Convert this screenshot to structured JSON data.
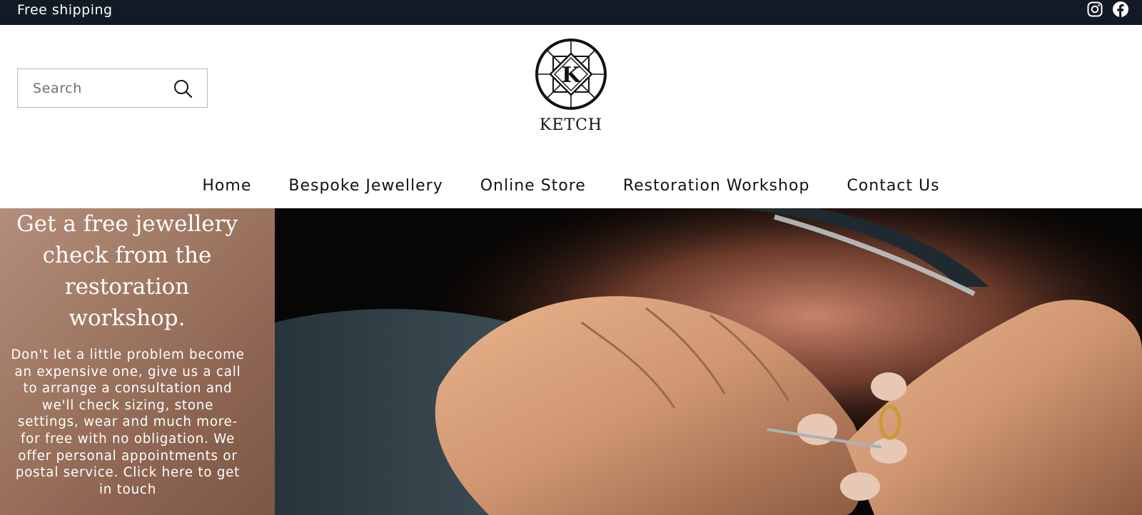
{
  "announcement": {
    "text": "Free shipping"
  },
  "social": {
    "instagram_icon": "instagram-icon",
    "facebook_icon": "facebook-icon"
  },
  "search": {
    "placeholder": "Search",
    "value": "",
    "icon": "search-icon"
  },
  "logo": {
    "letter": "K",
    "brand": "KETCH"
  },
  "nav": {
    "items": [
      {
        "label": "Home"
      },
      {
        "label": "Bespoke Jewellery"
      },
      {
        "label": "Online Store"
      },
      {
        "label": "Restoration Workshop"
      },
      {
        "label": "Contact Us"
      }
    ]
  },
  "hero": {
    "title": "Get a free jewellery check from the restoration workshop.",
    "body": "Don't let a little problem become an expensive one, give us a call to arrange a consultation and we'll check sizing, stone settings, wear and much more-for free with no obligation. We offer personal appointments or postal service.",
    "link": "Click here to get in touch"
  },
  "colors": {
    "announcement_bg": "#121a26",
    "text": "#121212",
    "hero_side_bg": "#a17a66"
  }
}
